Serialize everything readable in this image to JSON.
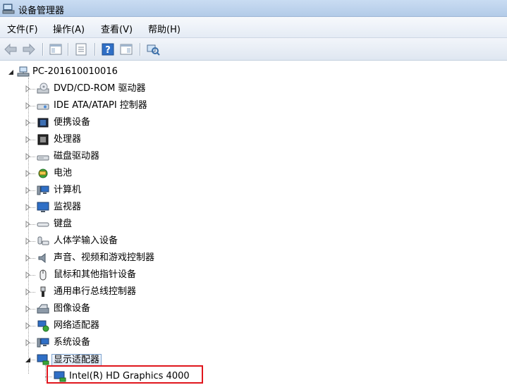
{
  "window": {
    "title": "设备管理器"
  },
  "menu": [
    {
      "label": "文件(F)"
    },
    {
      "label": "操作(A)"
    },
    {
      "label": "查看(V)"
    },
    {
      "label": "帮助(H)"
    }
  ],
  "toolbar": {
    "buttons": [
      "back-arrow-icon",
      "forward-arrow-icon",
      "show-hide-console-tree-icon",
      "properties-icon",
      "help-icon",
      "export-list-icon",
      "scan-hardware-icon"
    ]
  },
  "tree": {
    "root": {
      "label": "PC-201610010016",
      "expanded": true
    },
    "categories": [
      {
        "label": "DVD/CD-ROM 驱动器",
        "icon": "dvd-drive-icon"
      },
      {
        "label": "IDE ATA/ATAPI 控制器",
        "icon": "ide-controller-icon"
      },
      {
        "label": "便携设备",
        "icon": "portable-device-icon"
      },
      {
        "label": "处理器",
        "icon": "processor-icon"
      },
      {
        "label": "磁盘驱动器",
        "icon": "disk-drive-icon"
      },
      {
        "label": "电池",
        "icon": "battery-icon"
      },
      {
        "label": "计算机",
        "icon": "computer-icon"
      },
      {
        "label": "监视器",
        "icon": "monitor-icon"
      },
      {
        "label": "键盘",
        "icon": "keyboard-icon"
      },
      {
        "label": "人体学输入设备",
        "icon": "hid-icon"
      },
      {
        "label": "声音、视频和游戏控制器",
        "icon": "sound-icon"
      },
      {
        "label": "鼠标和其他指针设备",
        "icon": "mouse-icon"
      },
      {
        "label": "通用串行总线控制器",
        "icon": "usb-icon"
      },
      {
        "label": "图像设备",
        "icon": "imaging-device-icon"
      },
      {
        "label": "网络适配器",
        "icon": "network-adapter-icon"
      },
      {
        "label": "系统设备",
        "icon": "system-device-icon"
      },
      {
        "label": "显示适配器",
        "icon": "display-adapter-icon",
        "expanded": true
      }
    ],
    "display_child": {
      "label": "Intel(R) HD Graphics 4000",
      "icon": "display-adapter-icon"
    }
  }
}
